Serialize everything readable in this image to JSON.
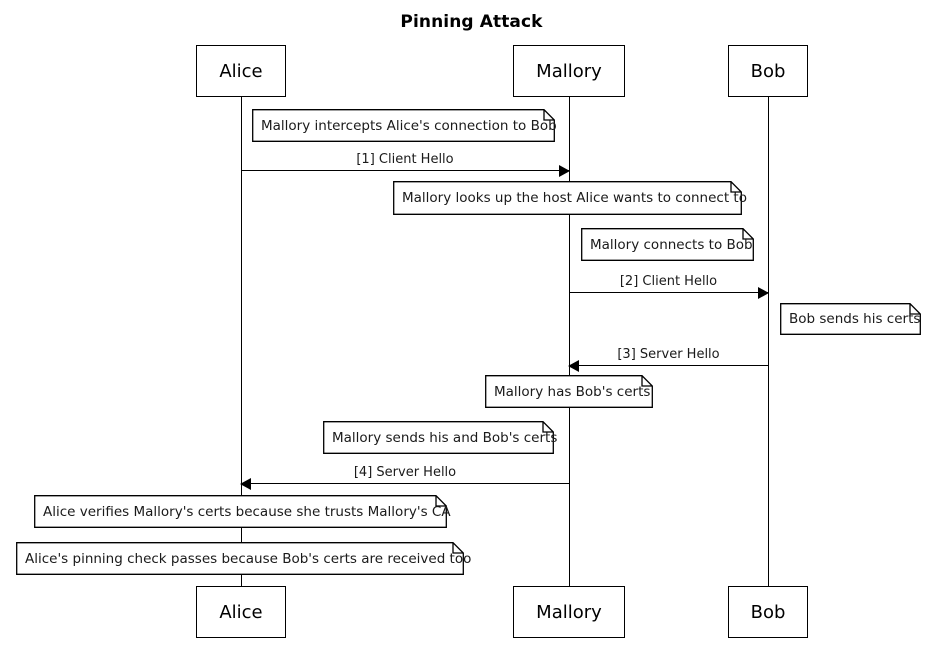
{
  "diagram": {
    "title": "Pinning Attack",
    "type": "sequence-diagram",
    "colors": {
      "stroke": "#000000",
      "background": "#ffffff",
      "text": "#1a1a1a"
    },
    "participants": [
      {
        "id": "alice",
        "label": "Alice"
      },
      {
        "id": "mallory",
        "label": "Mallory"
      },
      {
        "id": "bob",
        "label": "Bob"
      }
    ],
    "messages": [
      {
        "index": "1",
        "label": "[1] Client Hello",
        "from": "alice",
        "to": "mallory",
        "direction": "right"
      },
      {
        "index": "2",
        "label": "[2] Client Hello",
        "from": "mallory",
        "to": "bob",
        "direction": "right"
      },
      {
        "index": "3",
        "label": "[3] Server Hello",
        "from": "bob",
        "to": "mallory",
        "direction": "left"
      },
      {
        "index": "4",
        "label": "[4] Server Hello",
        "from": "mallory",
        "to": "alice",
        "direction": "left"
      }
    ],
    "notes": [
      {
        "id": "note-1",
        "text": "Mallory intercepts Alice's connection to Bob",
        "attached_to": "alice-mallory"
      },
      {
        "id": "note-2",
        "text": "Mallory looks up the host Alice wants to connect to",
        "attached_to": "mallory"
      },
      {
        "id": "note-3",
        "text": "Mallory connects to Bob",
        "attached_to": "mallory"
      },
      {
        "id": "note-4",
        "text": "Bob sends his certs",
        "attached_to": "bob"
      },
      {
        "id": "note-5",
        "text": "Mallory has Bob's certs",
        "attached_to": "mallory"
      },
      {
        "id": "note-6",
        "text": "Mallory sends his and Bob's certs",
        "attached_to": "mallory"
      },
      {
        "id": "note-7",
        "text": "Alice verifies Mallory's certs because she trusts Mallory's CA",
        "attached_to": "alice"
      },
      {
        "id": "note-8",
        "text": "Alice's pinning check passes because Bob's certs are received too",
        "attached_to": "alice"
      }
    ]
  }
}
